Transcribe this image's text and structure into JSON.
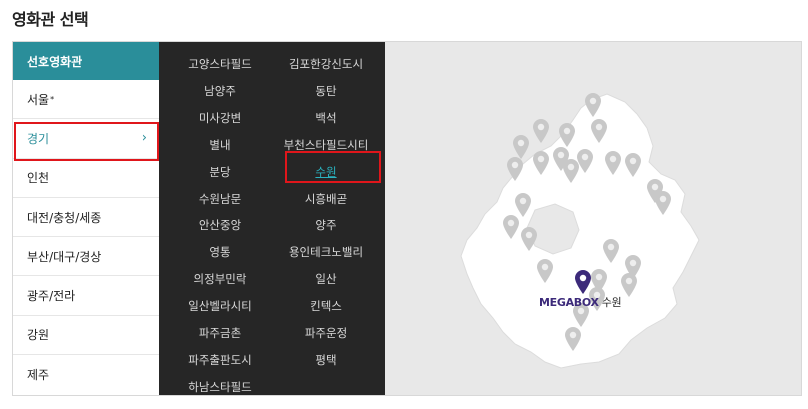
{
  "title": "영화관 선택",
  "region_panel": {
    "category": "선호영화관",
    "regions": [
      {
        "label": "서울",
        "badge": "*"
      },
      {
        "label": "경기",
        "arrow": "›"
      },
      {
        "label": "인천"
      },
      {
        "label": "대전/충청/세종"
      },
      {
        "label": "부산/대구/경상"
      },
      {
        "label": "광주/전라"
      },
      {
        "label": "강원"
      },
      {
        "label": "제주"
      }
    ]
  },
  "theaters": {
    "left_column": [
      "고양스타필드",
      "남양주",
      "미사강변",
      "별내",
      "분당",
      "수원남문",
      "안산중앙",
      "영통",
      "의정부민락",
      "일산벨라시티",
      "파주금촌",
      "파주출판도시",
      "하남스타필드"
    ],
    "right_column": [
      "김포한강신도시",
      "동탄",
      "백석",
      "부천스타필드시티",
      "수원",
      "시흥배곧",
      "양주",
      "용인테크노밸리",
      "일산",
      "킨텍스",
      "파주운정",
      "평택"
    ],
    "selected": "수원"
  },
  "map": {
    "brand": "MEGABOX",
    "selected_label": "수원",
    "region_color": "#ffffff",
    "background_color": "#e8e8e8",
    "pin_color": "#c8c8c8",
    "selected_pin_color": "#3c2a7a",
    "pin_icon": "map-pin-icon"
  },
  "colors": {
    "accent": "#2a8e9a",
    "dark_panel": "#262626",
    "highlight_border": "#e0161b",
    "selected_text": "#2ab3c0"
  }
}
